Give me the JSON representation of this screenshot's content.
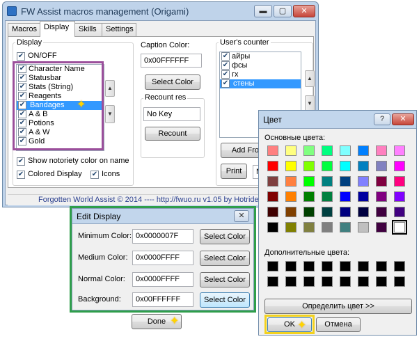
{
  "main_window": {
    "title": "FW Assist macros management (Origami)",
    "buttons": {
      "minimize": "▬",
      "maximize": "▢",
      "close": "✕"
    },
    "tabs": [
      {
        "label": "Macros",
        "active": false
      },
      {
        "label": "Display",
        "active": true
      },
      {
        "label": "Skills",
        "active": false
      },
      {
        "label": "Settings",
        "active": false
      }
    ],
    "display_group": {
      "label": "Display",
      "on_off": {
        "label": "ON/OFF",
        "checked": true
      },
      "items": [
        {
          "label": "Character Name",
          "checked": true,
          "selected": false
        },
        {
          "label": "Statusbar",
          "checked": true,
          "selected": false
        },
        {
          "label": "Stats (String)",
          "checked": true,
          "selected": false
        },
        {
          "label": "Reagents",
          "checked": true,
          "selected": false
        },
        {
          "label": "Bandages",
          "checked": true,
          "selected": true
        },
        {
          "label": "A & B",
          "checked": true,
          "selected": false
        },
        {
          "label": "Potions",
          "checked": true,
          "selected": false
        },
        {
          "label": "A & W",
          "checked": true,
          "selected": false
        },
        {
          "label": "Gold",
          "checked": true,
          "selected": false
        }
      ],
      "show_notoriety": {
        "label": "Show notoriety color on name",
        "checked": true
      },
      "colored_display": {
        "label": "Colored Display",
        "checked": true
      },
      "icons": {
        "label": "Icons",
        "checked": true
      }
    },
    "caption": {
      "label": "Caption Color:",
      "value": "0x00FFFFFF",
      "button": "Select Color"
    },
    "recount": {
      "label": "Recount res",
      "value": "No Key",
      "button": "Recount"
    },
    "users_counter": {
      "label": "User's counter",
      "items": [
        {
          "label": "айры",
          "checked": true,
          "selected": false
        },
        {
          "label": "фсы",
          "checked": true,
          "selected": false
        },
        {
          "label": "гх",
          "checked": true,
          "selected": false
        },
        {
          "label": "стены",
          "checked": true,
          "selected": true
        }
      ],
      "add_button": "Add From",
      "print_button": "Print",
      "n_field": "N"
    },
    "status_text": "Forgotten World Assist © 2014 ---- http://fwuo.ru    v1.05 by Hotride"
  },
  "edit_display": {
    "title": "Edit Display",
    "close": "✕",
    "rows": [
      {
        "label": "Minimum Color:",
        "value": "0x0000007F",
        "button": "Select Color"
      },
      {
        "label": "Medium Color:",
        "value": "0x0000FFFF",
        "button": "Select Color"
      },
      {
        "label": "Normal Color:",
        "value": "0x0000FFFF",
        "button": "Select Color"
      },
      {
        "label": "Background:",
        "value": "0x00FFFFFF",
        "button": "Select Color"
      }
    ],
    "done_button": "Done"
  },
  "color_dialog": {
    "title": "Цвет",
    "help": "?",
    "close": "✕",
    "basic_label": "Основные цвета:",
    "custom_label": "Дополнительные цвета:",
    "define_button": "Определить цвет >>",
    "ok_button": "OK",
    "cancel_button": "Отмена",
    "basic_colors": [
      "#ff8080",
      "#ffff80",
      "#80ff80",
      "#00ff80",
      "#80ffff",
      "#0080ff",
      "#ff80c0",
      "#ff80ff",
      "#ff0000",
      "#ffff00",
      "#80ff00",
      "#00ff40",
      "#00ffff",
      "#0080c0",
      "#8080c0",
      "#ff00ff",
      "#804040",
      "#ff8040",
      "#00ff00",
      "#008080",
      "#004080",
      "#8080ff",
      "#800040",
      "#ff0080",
      "#800000",
      "#ff8000",
      "#008000",
      "#008040",
      "#0000ff",
      "#0000a0",
      "#800080",
      "#8000ff",
      "#400000",
      "#804000",
      "#004000",
      "#004040",
      "#000080",
      "#000040",
      "#400040",
      "#400080",
      "#000000",
      "#808000",
      "#808040",
      "#808080",
      "#408080",
      "#c0c0c0",
      "#400040",
      "#ffffff"
    ],
    "selected_index": 47,
    "custom_colors": [
      "#000000",
      "#000000",
      "#000000",
      "#000000",
      "#000000",
      "#000000",
      "#000000",
      "#000000",
      "#000000",
      "#000000",
      "#000000",
      "#000000",
      "#000000",
      "#000000",
      "#000000",
      "#000000"
    ]
  },
  "accent_colors": {
    "purple_highlight": "#9b4f9b",
    "green_highlight": "#2f9e4b",
    "yellow_highlight": "#f3d21f",
    "link_blue": "#2a3f8f",
    "selection": "#3399ff"
  }
}
